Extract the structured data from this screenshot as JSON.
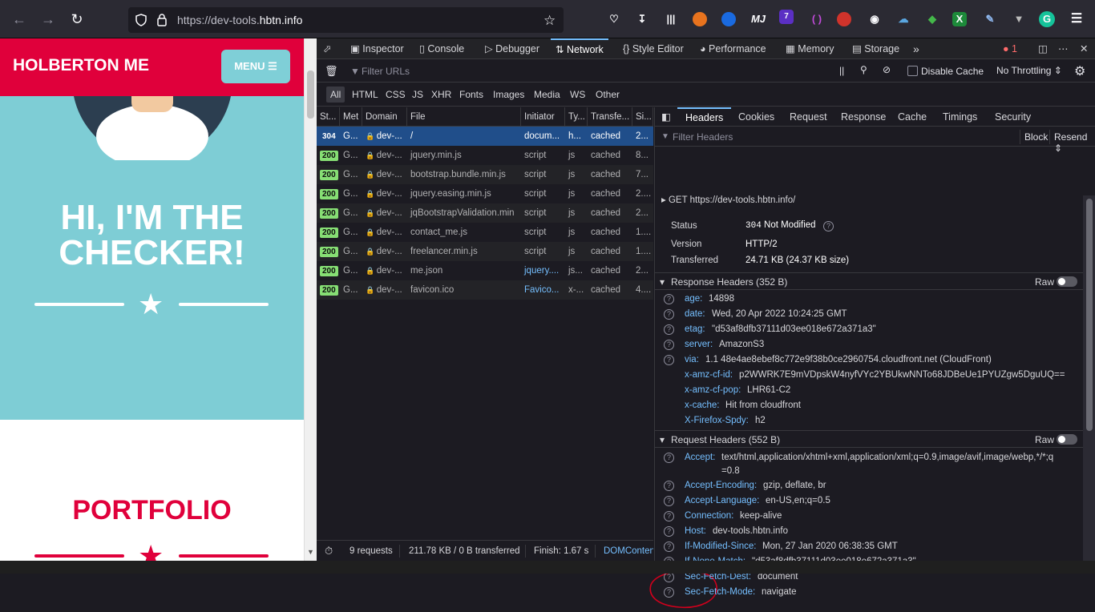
{
  "browser": {
    "url_prefix": "https://dev-tools.",
    "url_domain": "hbtn.info",
    "icons": [
      "back-icon",
      "forward-icon",
      "reload-icon",
      "shield-icon",
      "lock-icon",
      "star-icon",
      "pocket-icon",
      "download-icon",
      "library-icon"
    ],
    "ext_labels": {
      "mj": "MJ",
      "badge": "7",
      "sheets": "X",
      "g": "G"
    }
  },
  "page": {
    "brand": "HOLBERTON ME",
    "menu": "MENU",
    "hero_title_1": "HI, I'M THE",
    "hero_title_2": "CHECKER!",
    "portfolio": "PORTFOLIO"
  },
  "devtools": {
    "tabs": [
      "Inspector",
      "Console",
      "Debugger",
      "Network",
      "Style Editor",
      "Performance",
      "Memory",
      "Storage"
    ],
    "active_tab": "Network",
    "error_count": "1",
    "filter_placeholder": "Filter URLs",
    "disable_cache": "Disable Cache",
    "throttling": "No Throttling",
    "type_filters": [
      "All",
      "HTML",
      "CSS",
      "JS",
      "XHR",
      "Fonts",
      "Images",
      "Media",
      "WS",
      "Other"
    ],
    "columns": [
      "St...",
      "Met",
      "Domain",
      "File",
      "Initiator",
      "Ty...",
      "Transfe...",
      "Si..."
    ],
    "requests": [
      {
        "status": "304",
        "method": "G...",
        "domain": "dev-...",
        "file": "/",
        "initiator": "docum...",
        "type": "h...",
        "transferred": "cached",
        "size": "2..."
      },
      {
        "status": "200",
        "method": "G...",
        "domain": "dev-...",
        "file": "jquery.min.js",
        "initiator": "script",
        "type": "js",
        "transferred": "cached",
        "size": "8..."
      },
      {
        "status": "200",
        "method": "G...",
        "domain": "dev-...",
        "file": "bootstrap.bundle.min.js",
        "initiator": "script",
        "type": "js",
        "transferred": "cached",
        "size": "7..."
      },
      {
        "status": "200",
        "method": "G...",
        "domain": "dev-...",
        "file": "jquery.easing.min.js",
        "initiator": "script",
        "type": "js",
        "transferred": "cached",
        "size": "2...."
      },
      {
        "status": "200",
        "method": "G...",
        "domain": "dev-...",
        "file": "jqBootstrapValidation.min",
        "initiator": "script",
        "type": "js",
        "transferred": "cached",
        "size": "2..."
      },
      {
        "status": "200",
        "method": "G...",
        "domain": "dev-...",
        "file": "contact_me.js",
        "initiator": "script",
        "type": "js",
        "transferred": "cached",
        "size": "1...."
      },
      {
        "status": "200",
        "method": "G...",
        "domain": "dev-...",
        "file": "freelancer.min.js",
        "initiator": "script",
        "type": "js",
        "transferred": "cached",
        "size": "1...."
      },
      {
        "status": "200",
        "method": "G...",
        "domain": "dev-...",
        "file": "me.json",
        "initiator": "jquery....",
        "type": "js...",
        "transferred": "cached",
        "size": "2..."
      },
      {
        "status": "200",
        "method": "G...",
        "domain": "dev-...",
        "file": "favicon.ico",
        "initiator": "Favico...",
        "type": "x-...",
        "transferred": "cached",
        "size": "4...."
      }
    ],
    "summary": {
      "requests": "9 requests",
      "transferred": "211.78 KB / 0 B transferred",
      "finish": "Finish: 1.67 s",
      "domcontent": "DOMConten"
    },
    "side_tabs": [
      "Headers",
      "Cookies",
      "Request",
      "Response",
      "Cache",
      "Timings",
      "Security"
    ],
    "filter_headers": "Filter Headers",
    "block": "Block",
    "resend": "Resend",
    "request_line": {
      "method": "GET",
      "url": "https://dev-tools.hbtn.info/"
    },
    "summary_fields": [
      {
        "label": "Status",
        "code": "304",
        "value": "Not Modified"
      },
      {
        "label": "Version",
        "value": "HTTP/2"
      },
      {
        "label": "Transferred",
        "value": "24.71 KB (24.37 KB size)"
      }
    ],
    "raw": "Raw",
    "response_headers_title": "Response Headers (352 B)",
    "response_headers": [
      {
        "name": "age:",
        "value": "14898",
        "help": true
      },
      {
        "name": "date:",
        "value": "Wed, 20 Apr 2022 10:24:25 GMT",
        "help": true
      },
      {
        "name": "etag:",
        "value": "\"d53af8dfb37111d03ee018e672a371a3\"",
        "help": true
      },
      {
        "name": "server:",
        "value": "AmazonS3",
        "help": true
      },
      {
        "name": "via:",
        "value": "1.1 48e4ae8ebef8c772e9f38b0ce2960754.cloudfront.net (CloudFront)",
        "help": true
      },
      {
        "name": "x-amz-cf-id:",
        "value": "p2WWRK7E9mVDpskW4nyfVYc2YBUkwNNTo68JDBeUe1PYUZgw5DguUQ==",
        "help": false
      },
      {
        "name": "x-amz-cf-pop:",
        "value": "LHR61-C2",
        "help": false
      },
      {
        "name": "x-cache:",
        "value": "Hit from cloudfront",
        "help": false
      },
      {
        "name": "X-Firefox-Spdy:",
        "value": "h2",
        "help": false
      }
    ],
    "request_headers_title": "Request Headers (552 B)",
    "request_headers": [
      {
        "name": "Accept:",
        "value": "text/html,application/xhtml+xml,application/xml;q=0.9,image/avif,image/webp,*/*;q",
        "value2": "=0.8"
      },
      {
        "name": "Accept-Encoding:",
        "value": "gzip, deflate, br"
      },
      {
        "name": "Accept-Language:",
        "value": "en-US,en;q=0.5"
      },
      {
        "name": "Connection:",
        "value": "keep-alive"
      },
      {
        "name": "Host:",
        "value": "dev-tools.hbtn.info"
      },
      {
        "name": "If-Modified-Since:",
        "value": "Mon, 27 Jan 2020 06:38:35 GMT"
      },
      {
        "name": "If-None-Match:",
        "value": "\"d53af8dfb37111d03ee018e672a371a3\""
      },
      {
        "name": "Sec-Fetch-Dest:",
        "value": "document"
      },
      {
        "name": "Sec-Fetch-Mode:",
        "value": "navigate"
      }
    ]
  },
  "colors": {
    "brand_red": "#e0003b",
    "hero_teal": "#7ecdd5",
    "selected_row": "#204e8a",
    "header_name": "#75bfff",
    "status_green": "#86de74",
    "annotation_red": "#d0001c"
  }
}
